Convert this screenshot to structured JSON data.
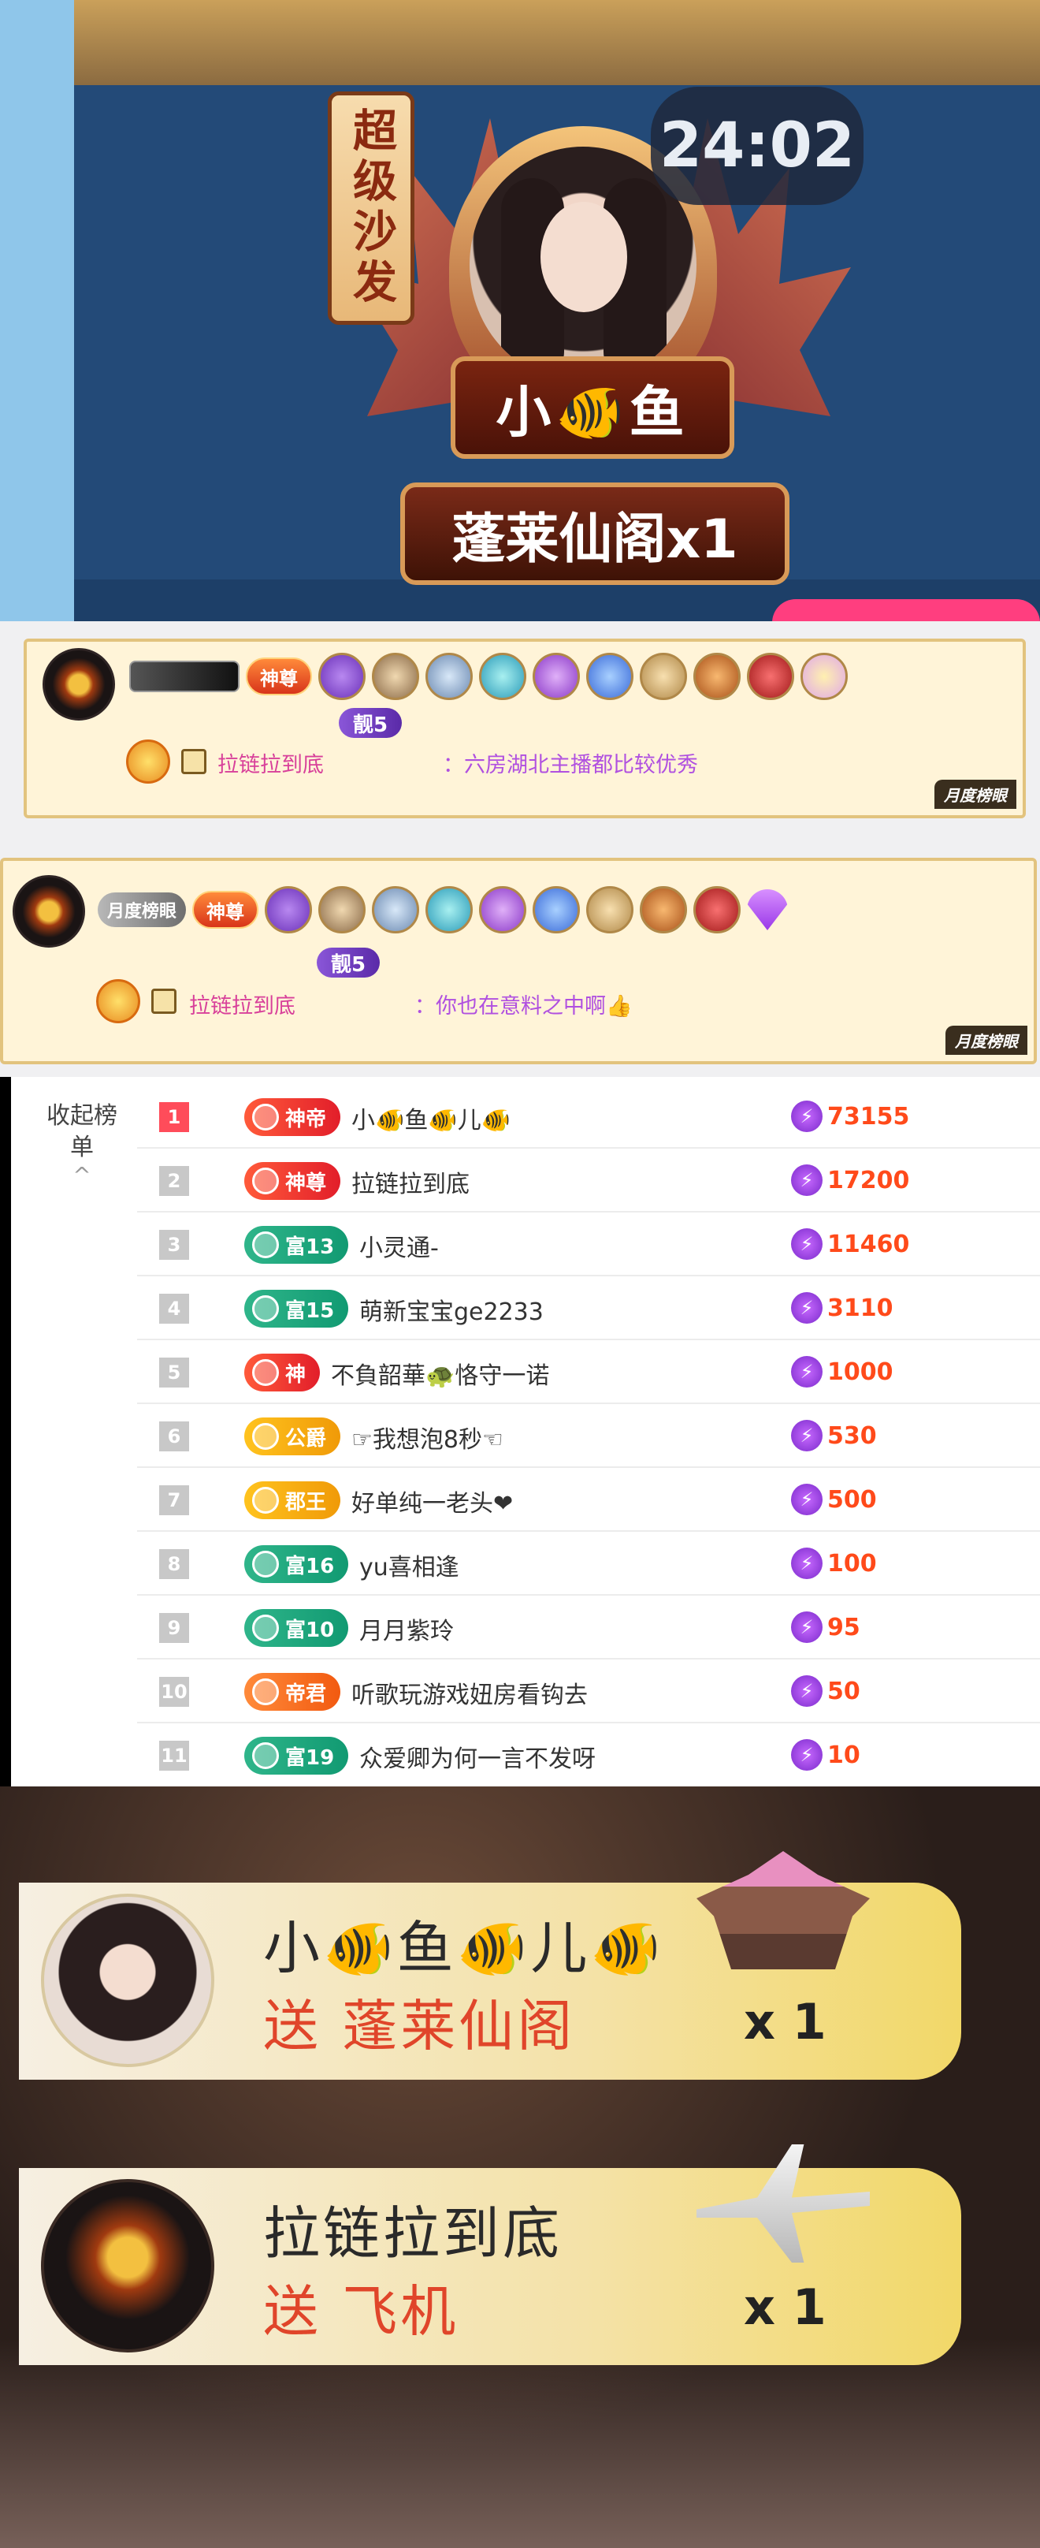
{
  "sofa_card": {
    "tag": "超级沙发",
    "timer": "24:02",
    "name": "小🐠鱼",
    "gift_line": "蓬莱仙阁x1"
  },
  "chat_messages": [
    {
      "rank_badge": "神尊",
      "level_badge": "靓5",
      "username": "拉链拉到底",
      "message": "：六房湖北主播都比较优秀",
      "tag": "月度榜眼"
    },
    {
      "month_pill": "月度榜眼",
      "rank_badge": "神尊",
      "level_badge": "靓5",
      "username": "拉链拉到底",
      "message": "：你也在意料之中啊👍",
      "tag": "月度榜眼"
    }
  ],
  "leaderboard": {
    "collapse_label": "收起榜单",
    "chevron": "^",
    "rows": [
      {
        "rank": "1",
        "tier": "神帝",
        "tier_color": "red",
        "name": "小🐠鱼🐠儿🐠",
        "score": "73155"
      },
      {
        "rank": "2",
        "tier": "神尊",
        "tier_color": "red",
        "name": "拉链拉到底",
        "score": "17200"
      },
      {
        "rank": "3",
        "tier": "富13",
        "tier_color": "green",
        "name": "小灵通-",
        "score": "11460"
      },
      {
        "rank": "4",
        "tier": "富15",
        "tier_color": "green",
        "name": "萌新宝宝ge2233",
        "score": "3110"
      },
      {
        "rank": "5",
        "tier": "神",
        "tier_color": "red",
        "name": "不負韶華🐢恪守一诺",
        "score": "1000"
      },
      {
        "rank": "6",
        "tier": "公爵",
        "tier_color": "gold",
        "name": "☞我想泡8秒☜",
        "score": "530"
      },
      {
        "rank": "7",
        "tier": "郡王",
        "tier_color": "gold",
        "name": "好单纯一老头❤",
        "score": "500"
      },
      {
        "rank": "8",
        "tier": "富16",
        "tier_color": "green",
        "name": "yu喜相逢",
        "score": "100"
      },
      {
        "rank": "9",
        "tier": "富10",
        "tier_color": "green",
        "name": "月月紫玲",
        "score": "95"
      },
      {
        "rank": "10",
        "tier": "帝君",
        "tier_color": "orange",
        "name": "听歌玩游戏妞房看钩去",
        "score": "50"
      },
      {
        "rank": "11",
        "tier": "富19",
        "tier_color": "green",
        "name": "众爱卿为何一言不发呀",
        "score": "10"
      }
    ]
  },
  "gift_banners": [
    {
      "name": "小🐠鱼🐠儿🐠",
      "gift": "送 蓬莱仙阁",
      "count": "x 1"
    },
    {
      "name": "拉链拉到底",
      "gift": "送 飞机",
      "count": "x 1"
    }
  ]
}
